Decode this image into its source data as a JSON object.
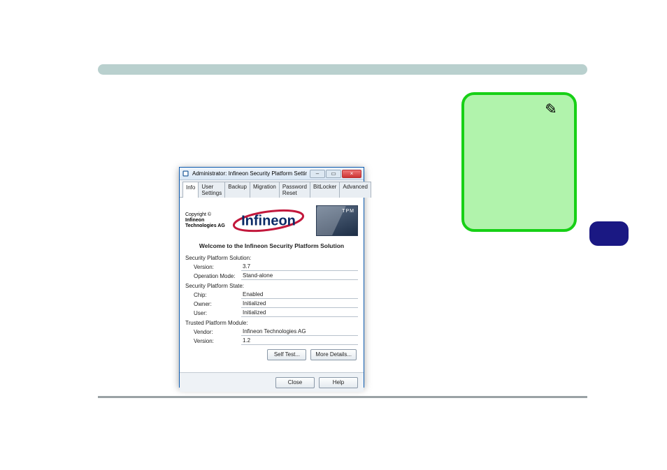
{
  "note": {
    "pen_glyph": "✎"
  },
  "dialog": {
    "title": "Administrator: Infineon Security Platform Settings Tool",
    "win": {
      "min": "–",
      "max": "▭",
      "close": "×"
    },
    "tabs": {
      "info": "Info",
      "user_settings": "User Settings",
      "backup": "Backup",
      "migration": "Migration",
      "password_reset": "Password Reset",
      "bitlocker": "BitLocker",
      "advanced": "Advanced"
    },
    "copyright_line1": "Copyright ©",
    "copyright_line2": "Infineon Technologies AG",
    "logo_text": "Infineon",
    "chip_label": "TPM",
    "welcome": "Welcome to the Infineon Security Platform Solution",
    "sections": {
      "solution": {
        "label": "Security Platform Solution:",
        "rows": {
          "version": {
            "k": "Version:",
            "v": "3.7"
          },
          "operation_mode": {
            "k": "Operation Mode:",
            "v": "Stand-alone"
          }
        }
      },
      "state": {
        "label": "Security Platform State:",
        "rows": {
          "chip": {
            "k": "Chip:",
            "v": "Enabled"
          },
          "owner": {
            "k": "Owner:",
            "v": "Initialized"
          },
          "user": {
            "k": "User:",
            "v": "Initialized"
          }
        }
      },
      "tpm": {
        "label": "Trusted Platform Module:",
        "rows": {
          "vendor": {
            "k": "Vendor:",
            "v": "Infineon Technologies AG"
          },
          "version": {
            "k": "Version:",
            "v": "1.2"
          }
        }
      }
    },
    "buttons": {
      "self_test": "Self Test...",
      "more_details": "More Details...",
      "close": "Close",
      "help": "Help"
    }
  }
}
